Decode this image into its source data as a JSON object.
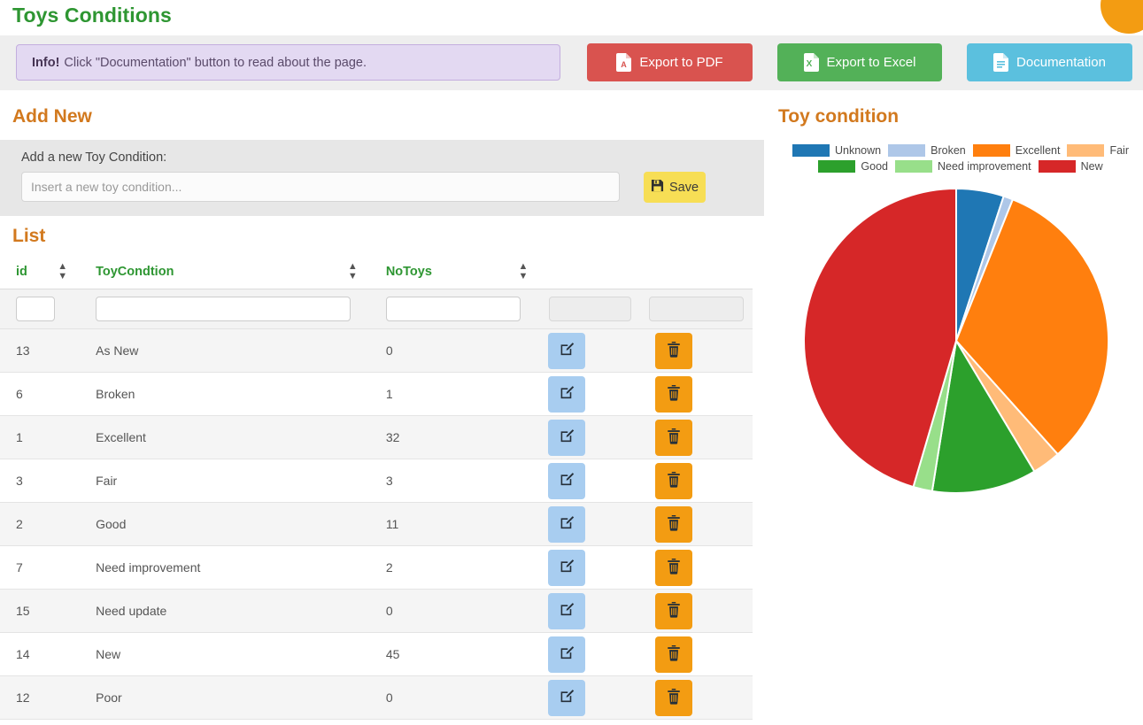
{
  "header": {
    "title": "Toys Conditions",
    "info_prefix": "Info!",
    "info_text": "Click \"Documentation\" button to read about the page.",
    "buttons": [
      {
        "id": "pdf",
        "label": "Export to PDF",
        "icon": "pdf-file-icon",
        "color": "#d9534f"
      },
      {
        "id": "excel",
        "label": "Export to Excel",
        "icon": "excel-file-icon",
        "color": "#53b158"
      },
      {
        "id": "doc",
        "label": "Documentation",
        "icon": "document-icon",
        "color": "#5bc0de"
      }
    ]
  },
  "add_new": {
    "heading": "Add New",
    "field_label": "Add a new Toy Condition:",
    "input_value": "",
    "input_placeholder": "Insert a new toy condition...",
    "save_label": "Save",
    "save_icon": "floppy-disk-icon"
  },
  "list": {
    "heading": "List",
    "columns": [
      {
        "key": "id",
        "label": "id",
        "sortable": true
      },
      {
        "key": "cond",
        "label": "ToyCondtion",
        "sortable": true
      },
      {
        "key": "no",
        "label": "NoToys",
        "sortable": true
      },
      {
        "key": "edit",
        "label": "",
        "sortable": false
      },
      {
        "key": "del",
        "label": "",
        "sortable": false
      }
    ],
    "filters": [
      {
        "key": "id",
        "value": "",
        "disabled": false
      },
      {
        "key": "cond",
        "value": "",
        "disabled": false
      },
      {
        "key": "no",
        "value": "",
        "disabled": false
      },
      {
        "key": "edit",
        "value": "",
        "disabled": true
      },
      {
        "key": "del",
        "value": "",
        "disabled": true
      }
    ],
    "edit_icon": "pencil-square-icon",
    "delete_icon": "trash-icon",
    "rows": [
      {
        "id": "13",
        "cond": "As New",
        "no": "0"
      },
      {
        "id": "6",
        "cond": "Broken",
        "no": "1"
      },
      {
        "id": "1",
        "cond": "Excellent",
        "no": "32"
      },
      {
        "id": "3",
        "cond": "Fair",
        "no": "3"
      },
      {
        "id": "2",
        "cond": "Good",
        "no": "11"
      },
      {
        "id": "7",
        "cond": "Need improvement",
        "no": "2"
      },
      {
        "id": "15",
        "cond": "Need update",
        "no": "0"
      },
      {
        "id": "14",
        "cond": "New",
        "no": "45"
      },
      {
        "id": "12",
        "cond": "Poor",
        "no": "0"
      }
    ]
  },
  "chart_data": {
    "type": "pie",
    "title": "Toy condition",
    "legend_position": "top",
    "categories": [
      "Unknown",
      "Broken",
      "Excellent",
      "Fair",
      "Good",
      "Need improvement",
      "New"
    ],
    "values": [
      5,
      1,
      32,
      3,
      11,
      2,
      45
    ],
    "colors": [
      "#1f77b4",
      "#aec7e8",
      "#ff7f0e",
      "#ffbb78",
      "#2ca02c",
      "#98df8a",
      "#d62728"
    ],
    "legend_rows": [
      [
        "Unknown",
        "Broken",
        "Excellent",
        "Fair"
      ],
      [
        "Good",
        "Need improvement",
        "New"
      ]
    ],
    "start_angle_deg": -90,
    "direction": "clockwise",
    "radius_px": 172
  },
  "colors": {
    "accent_green": "#2e9632",
    "accent_orange": "#d2791e",
    "edit_blue": "#a8cdf0",
    "delete_orange": "#f39c12",
    "save_yellow": "#f7de55",
    "corner_badge": "#f39c12"
  }
}
